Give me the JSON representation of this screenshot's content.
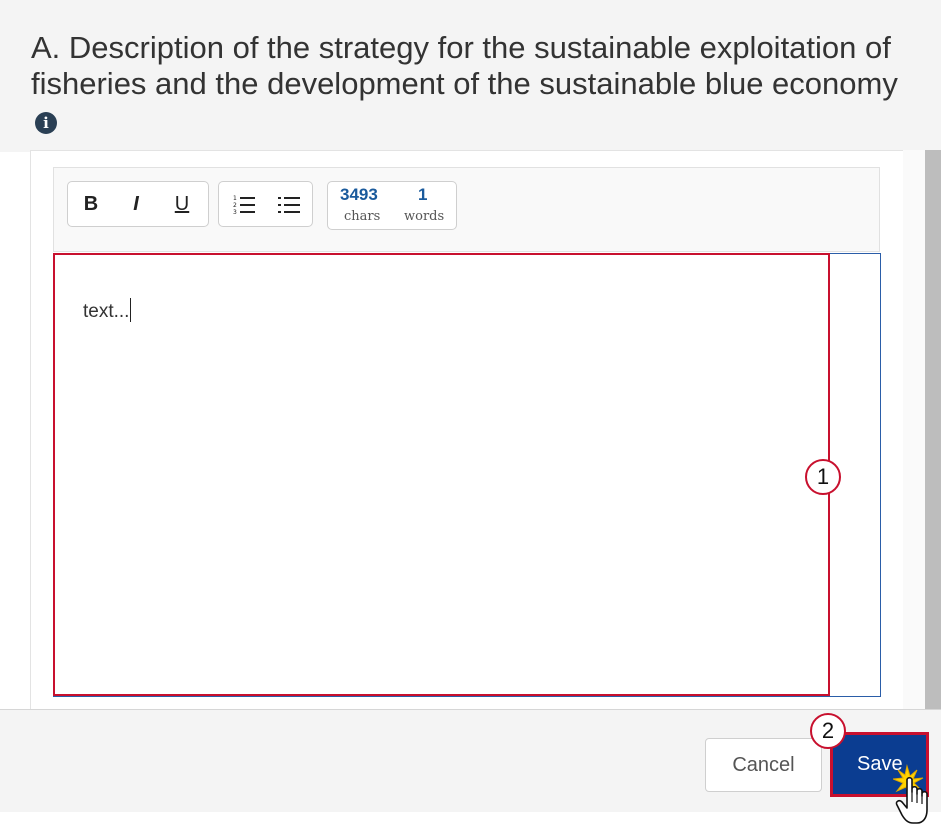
{
  "section": {
    "title": "A. Description of the strategy for the sustainable exploitation of fisheries and the development of the sustainable blue economy",
    "info_icon": "info-icon"
  },
  "toolbar": {
    "bold_label": "B",
    "italic_label": "I",
    "underline_label": "U",
    "ordered_list_icon": "ordered-list-icon",
    "bullet_list_icon": "bullet-list-icon",
    "chars_count": "3493",
    "chars_label": "chars",
    "words_count": "1",
    "words_label": "words"
  },
  "editor": {
    "value": "text..."
  },
  "annotations": {
    "callout_1": "1",
    "callout_2": "2",
    "highlight_color": "#c8102e"
  },
  "footer": {
    "cancel_label": "Cancel",
    "save_label": "Save"
  },
  "colors": {
    "primary": "#0b3d91",
    "counter_number": "#1a5a9c"
  }
}
